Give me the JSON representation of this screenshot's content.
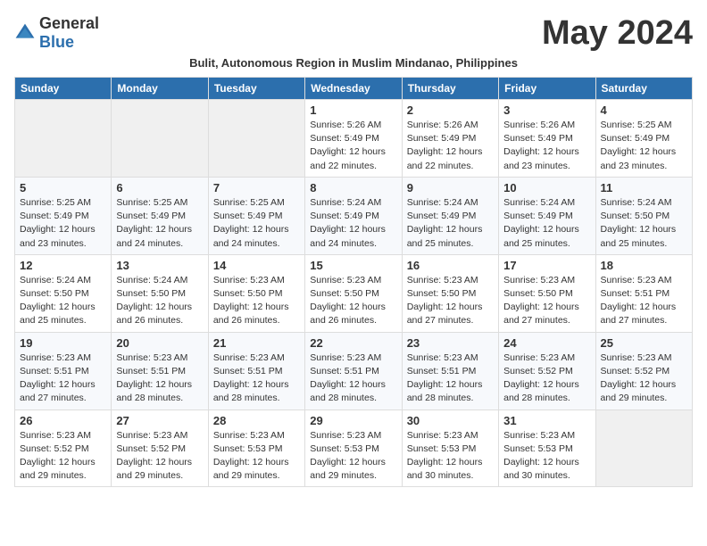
{
  "header": {
    "logo_general": "General",
    "logo_blue": "Blue",
    "month_title": "May 2024",
    "subtitle": "Bulit, Autonomous Region in Muslim Mindanao, Philippines"
  },
  "days_of_week": [
    "Sunday",
    "Monday",
    "Tuesday",
    "Wednesday",
    "Thursday",
    "Friday",
    "Saturday"
  ],
  "weeks": [
    {
      "cells": [
        {
          "empty": true
        },
        {
          "empty": true
        },
        {
          "empty": true
        },
        {
          "day": 1,
          "sunrise": "Sunrise: 5:26 AM",
          "sunset": "Sunset: 5:49 PM",
          "daylight": "Daylight: 12 hours and 22 minutes."
        },
        {
          "day": 2,
          "sunrise": "Sunrise: 5:26 AM",
          "sunset": "Sunset: 5:49 PM",
          "daylight": "Daylight: 12 hours and 22 minutes."
        },
        {
          "day": 3,
          "sunrise": "Sunrise: 5:26 AM",
          "sunset": "Sunset: 5:49 PM",
          "daylight": "Daylight: 12 hours and 23 minutes."
        },
        {
          "day": 4,
          "sunrise": "Sunrise: 5:25 AM",
          "sunset": "Sunset: 5:49 PM",
          "daylight": "Daylight: 12 hours and 23 minutes."
        }
      ]
    },
    {
      "cells": [
        {
          "day": 5,
          "sunrise": "Sunrise: 5:25 AM",
          "sunset": "Sunset: 5:49 PM",
          "daylight": "Daylight: 12 hours and 23 minutes."
        },
        {
          "day": 6,
          "sunrise": "Sunrise: 5:25 AM",
          "sunset": "Sunset: 5:49 PM",
          "daylight": "Daylight: 12 hours and 24 minutes."
        },
        {
          "day": 7,
          "sunrise": "Sunrise: 5:25 AM",
          "sunset": "Sunset: 5:49 PM",
          "daylight": "Daylight: 12 hours and 24 minutes."
        },
        {
          "day": 8,
          "sunrise": "Sunrise: 5:24 AM",
          "sunset": "Sunset: 5:49 PM",
          "daylight": "Daylight: 12 hours and 24 minutes."
        },
        {
          "day": 9,
          "sunrise": "Sunrise: 5:24 AM",
          "sunset": "Sunset: 5:49 PM",
          "daylight": "Daylight: 12 hours and 25 minutes."
        },
        {
          "day": 10,
          "sunrise": "Sunrise: 5:24 AM",
          "sunset": "Sunset: 5:49 PM",
          "daylight": "Daylight: 12 hours and 25 minutes."
        },
        {
          "day": 11,
          "sunrise": "Sunrise: 5:24 AM",
          "sunset": "Sunset: 5:50 PM",
          "daylight": "Daylight: 12 hours and 25 minutes."
        }
      ]
    },
    {
      "cells": [
        {
          "day": 12,
          "sunrise": "Sunrise: 5:24 AM",
          "sunset": "Sunset: 5:50 PM",
          "daylight": "Daylight: 12 hours and 25 minutes."
        },
        {
          "day": 13,
          "sunrise": "Sunrise: 5:24 AM",
          "sunset": "Sunset: 5:50 PM",
          "daylight": "Daylight: 12 hours and 26 minutes."
        },
        {
          "day": 14,
          "sunrise": "Sunrise: 5:23 AM",
          "sunset": "Sunset: 5:50 PM",
          "daylight": "Daylight: 12 hours and 26 minutes."
        },
        {
          "day": 15,
          "sunrise": "Sunrise: 5:23 AM",
          "sunset": "Sunset: 5:50 PM",
          "daylight": "Daylight: 12 hours and 26 minutes."
        },
        {
          "day": 16,
          "sunrise": "Sunrise: 5:23 AM",
          "sunset": "Sunset: 5:50 PM",
          "daylight": "Daylight: 12 hours and 27 minutes."
        },
        {
          "day": 17,
          "sunrise": "Sunrise: 5:23 AM",
          "sunset": "Sunset: 5:50 PM",
          "daylight": "Daylight: 12 hours and 27 minutes."
        },
        {
          "day": 18,
          "sunrise": "Sunrise: 5:23 AM",
          "sunset": "Sunset: 5:51 PM",
          "daylight": "Daylight: 12 hours and 27 minutes."
        }
      ]
    },
    {
      "cells": [
        {
          "day": 19,
          "sunrise": "Sunrise: 5:23 AM",
          "sunset": "Sunset: 5:51 PM",
          "daylight": "Daylight: 12 hours and 27 minutes."
        },
        {
          "day": 20,
          "sunrise": "Sunrise: 5:23 AM",
          "sunset": "Sunset: 5:51 PM",
          "daylight": "Daylight: 12 hours and 28 minutes."
        },
        {
          "day": 21,
          "sunrise": "Sunrise: 5:23 AM",
          "sunset": "Sunset: 5:51 PM",
          "daylight": "Daylight: 12 hours and 28 minutes."
        },
        {
          "day": 22,
          "sunrise": "Sunrise: 5:23 AM",
          "sunset": "Sunset: 5:51 PM",
          "daylight": "Daylight: 12 hours and 28 minutes."
        },
        {
          "day": 23,
          "sunrise": "Sunrise: 5:23 AM",
          "sunset": "Sunset: 5:51 PM",
          "daylight": "Daylight: 12 hours and 28 minutes."
        },
        {
          "day": 24,
          "sunrise": "Sunrise: 5:23 AM",
          "sunset": "Sunset: 5:52 PM",
          "daylight": "Daylight: 12 hours and 28 minutes."
        },
        {
          "day": 25,
          "sunrise": "Sunrise: 5:23 AM",
          "sunset": "Sunset: 5:52 PM",
          "daylight": "Daylight: 12 hours and 29 minutes."
        }
      ]
    },
    {
      "cells": [
        {
          "day": 26,
          "sunrise": "Sunrise: 5:23 AM",
          "sunset": "Sunset: 5:52 PM",
          "daylight": "Daylight: 12 hours and 29 minutes."
        },
        {
          "day": 27,
          "sunrise": "Sunrise: 5:23 AM",
          "sunset": "Sunset: 5:52 PM",
          "daylight": "Daylight: 12 hours and 29 minutes."
        },
        {
          "day": 28,
          "sunrise": "Sunrise: 5:23 AM",
          "sunset": "Sunset: 5:53 PM",
          "daylight": "Daylight: 12 hours and 29 minutes."
        },
        {
          "day": 29,
          "sunrise": "Sunrise: 5:23 AM",
          "sunset": "Sunset: 5:53 PM",
          "daylight": "Daylight: 12 hours and 29 minutes."
        },
        {
          "day": 30,
          "sunrise": "Sunrise: 5:23 AM",
          "sunset": "Sunset: 5:53 PM",
          "daylight": "Daylight: 12 hours and 30 minutes."
        },
        {
          "day": 31,
          "sunrise": "Sunrise: 5:23 AM",
          "sunset": "Sunset: 5:53 PM",
          "daylight": "Daylight: 12 hours and 30 minutes."
        },
        {
          "empty": true
        }
      ]
    }
  ]
}
